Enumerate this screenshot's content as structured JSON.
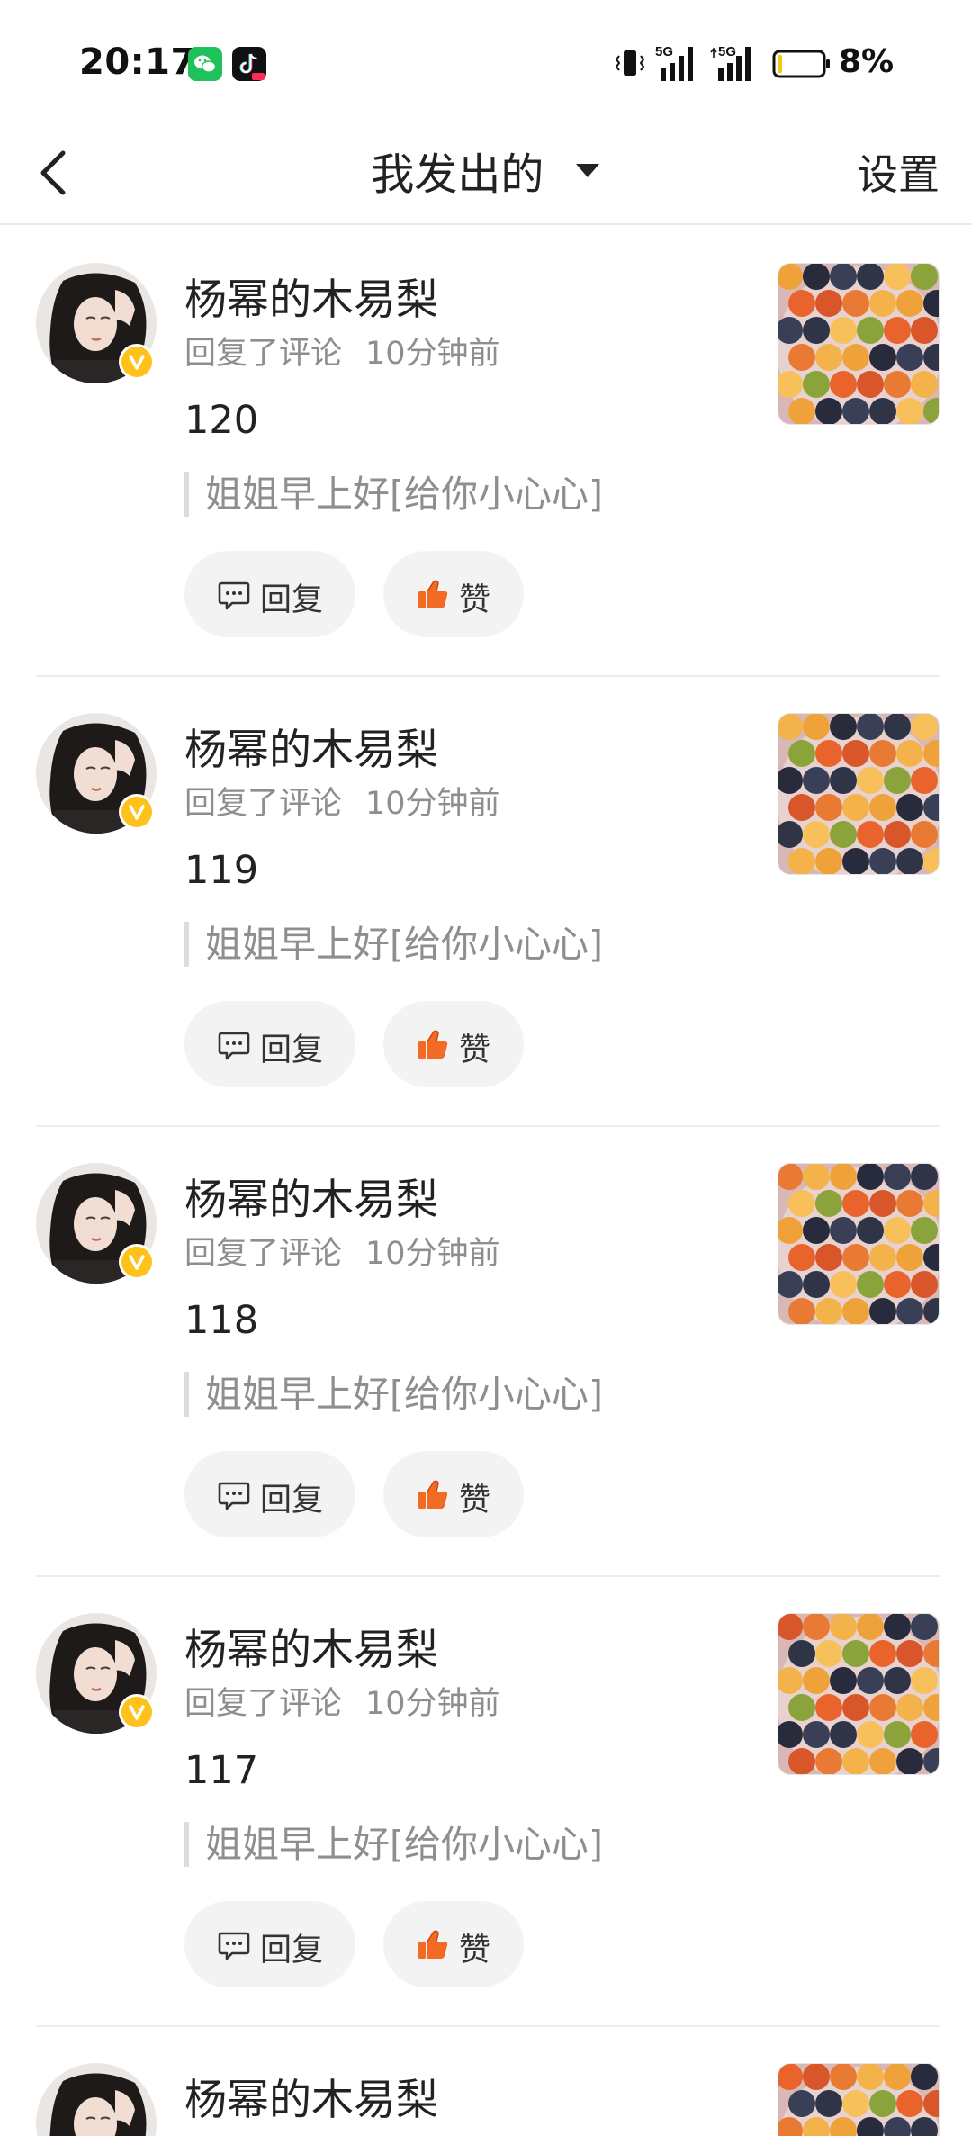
{
  "status_bar": {
    "time": "20:17",
    "battery": "8%",
    "network_1": "5G",
    "network_2": "5G",
    "icons": [
      "wechat-icon",
      "tiktok-icon",
      "vibrate-icon",
      "signal-icon",
      "battery-icon"
    ]
  },
  "header": {
    "title": "我发出的",
    "settings_label": "设置"
  },
  "colors": {
    "badge": "#ffc21a",
    "like": "#f26a24",
    "muted_text": "#8e8e8e",
    "button_bg": "#f3f3f3"
  },
  "items": [
    {
      "user": "杨幂的木易梨",
      "action": "回复了评论",
      "time": "10分钟前",
      "comment": "120",
      "quote": "姐姐早上好[给你小心心]",
      "reply_label": "回复",
      "like_label": "赞"
    },
    {
      "user": "杨幂的木易梨",
      "action": "回复了评论",
      "time": "10分钟前",
      "comment": "119",
      "quote": "姐姐早上好[给你小心心]",
      "reply_label": "回复",
      "like_label": "赞"
    },
    {
      "user": "杨幂的木易梨",
      "action": "回复了评论",
      "time": "10分钟前",
      "comment": "118",
      "quote": "姐姐早上好[给你小心心]",
      "reply_label": "回复",
      "like_label": "赞"
    },
    {
      "user": "杨幂的木易梨",
      "action": "回复了评论",
      "time": "10分钟前",
      "comment": "117",
      "quote": "姐姐早上好[给你小心心]",
      "reply_label": "回复",
      "like_label": "赞"
    },
    {
      "user": "杨幂的木易梨"
    }
  ]
}
